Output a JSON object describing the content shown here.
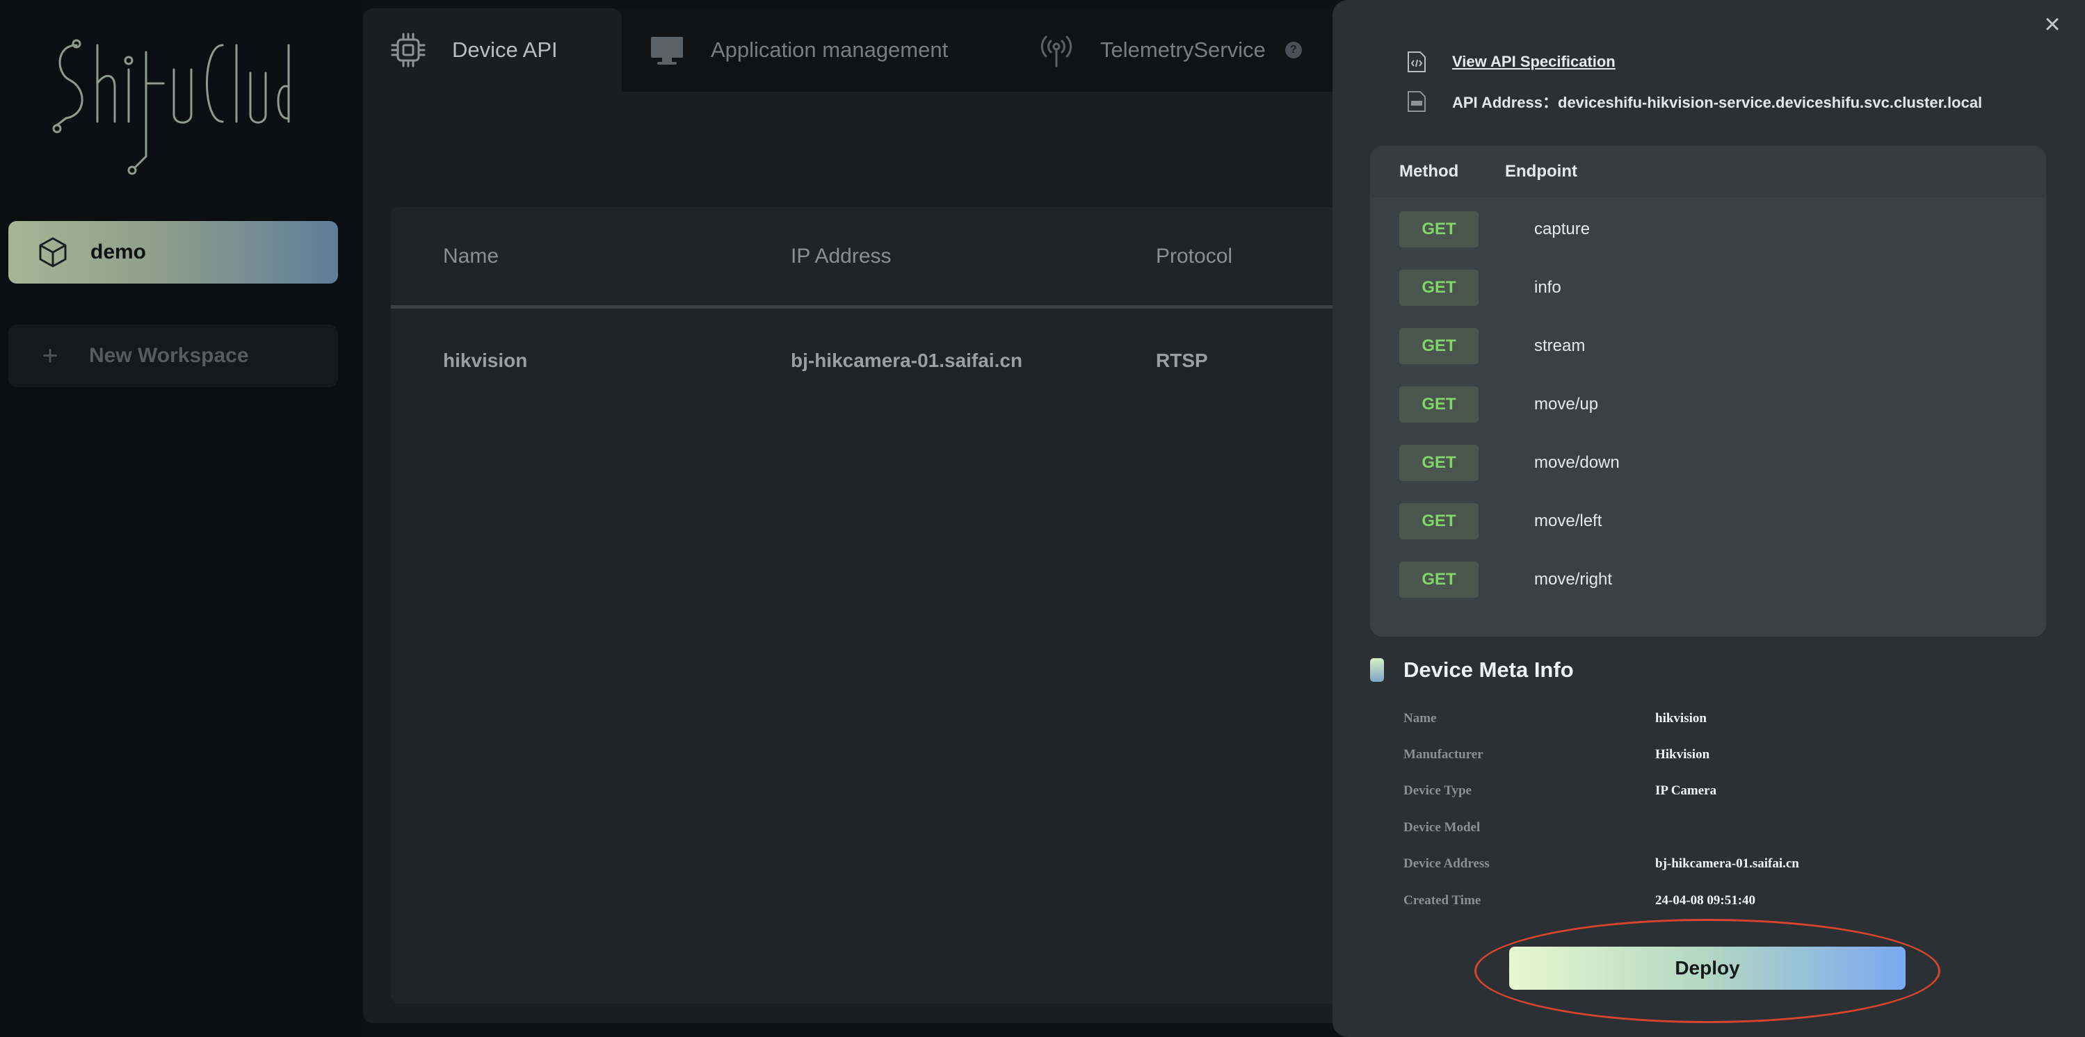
{
  "logo": {
    "text": "Shifu Cloud"
  },
  "sidebar": {
    "active_workspace": "demo",
    "new_workspace_label": "New Workspace"
  },
  "tabs": [
    {
      "label": "Device API"
    },
    {
      "label": "Application management"
    },
    {
      "label": "TelemetryService"
    }
  ],
  "help_glyph": "?",
  "table": {
    "headers": [
      "Name",
      "IP Address",
      "Protocol"
    ],
    "rows": [
      [
        "hikvision",
        "bj-hikcamera-01.saifai.cn",
        "RTSP"
      ]
    ]
  },
  "drawer": {
    "close_glyph": "×",
    "view_spec_label": "View API Specification",
    "api_address": "API Address：deviceshifu-hikvision-service.deviceshifu.svc.cluster.local",
    "api_table": {
      "headers": [
        "Method",
        "Endpoint"
      ],
      "rows": [
        {
          "method": "GET",
          "endpoint": "capture"
        },
        {
          "method": "GET",
          "endpoint": "info"
        },
        {
          "method": "GET",
          "endpoint": "stream"
        },
        {
          "method": "GET",
          "endpoint": "move/up"
        },
        {
          "method": "GET",
          "endpoint": "move/down"
        },
        {
          "method": "GET",
          "endpoint": "move/left"
        },
        {
          "method": "GET",
          "endpoint": "move/right"
        }
      ]
    },
    "meta_title": "Device Meta Info",
    "meta": [
      {
        "key": "Name",
        "value": "hikvision"
      },
      {
        "key": "Manufacturer",
        "value": "Hikvision"
      },
      {
        "key": "Device Type",
        "value": "IP Camera"
      },
      {
        "key": "Device Model",
        "value": ""
      },
      {
        "key": "Device Address",
        "value": "bj-hikcamera-01.saifai.cn"
      },
      {
        "key": "Created Time",
        "value": "24-04-08 09:51:40"
      }
    ],
    "deploy_label": "Deploy"
  },
  "colors": {
    "accent_green": "#82d46a",
    "highlight_ring": "#d9442f"
  }
}
